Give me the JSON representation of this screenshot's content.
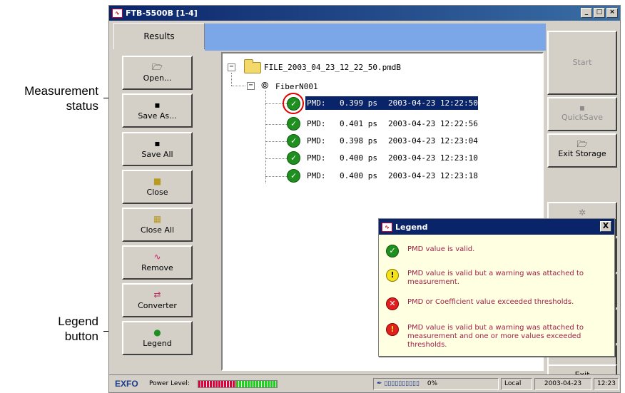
{
  "callouts": {
    "measurement_status_line1": "Measurement",
    "measurement_status_line2": "status",
    "legend_button_line1": "Legend",
    "legend_button_line2": "button"
  },
  "window": {
    "title": "FTB-5500B [1-4]",
    "minimize": "_",
    "maximize": "□",
    "close": "×"
  },
  "tabs": {
    "results": "Results"
  },
  "left_buttons": [
    {
      "label": "Open...",
      "icon": "open-folder-icon"
    },
    {
      "label": "Save As...",
      "icon": "floppy-icon"
    },
    {
      "label": "Save All",
      "icon": "floppy-icon"
    },
    {
      "label": "Close",
      "icon": "folder-icon"
    },
    {
      "label": "Close All",
      "icon": "folders-icon"
    },
    {
      "label": "Remove",
      "icon": "remove-icon"
    },
    {
      "label": "Converter",
      "icon": "converter-icon"
    },
    {
      "label": "Legend",
      "icon": "legend-icon"
    }
  ],
  "tree": {
    "file_name": "FILE_2003_04_23_12_22_50.pmdB",
    "fiber_name": "FiberN001",
    "measurements": [
      {
        "label": "PMD:",
        "value": "0.399 ps",
        "timestamp": "2003-04-23 12:22:50",
        "status": "valid",
        "selected": true
      },
      {
        "label": "PMD:",
        "value": "0.401 ps",
        "timestamp": "2003-04-23 12:22:56",
        "status": "valid",
        "selected": false
      },
      {
        "label": "PMD:",
        "value": "0.398 ps",
        "timestamp": "2003-04-23 12:23:04",
        "status": "valid",
        "selected": false
      },
      {
        "label": "PMD:",
        "value": "0.400 ps",
        "timestamp": "2003-04-23 12:23:10",
        "status": "valid",
        "selected": false
      },
      {
        "label": "PMD:",
        "value": "0.400 ps",
        "timestamp": "2003-04-23 12:23:18",
        "status": "valid",
        "selected": false
      }
    ]
  },
  "right_buttons": {
    "start": "Start",
    "quicksave": "QuickSave",
    "exit_storage": "Exit Storage",
    "exit": "Exit"
  },
  "legend": {
    "title": "Legend",
    "close": "X",
    "items": [
      {
        "status": "valid",
        "text": "PMD value is valid."
      },
      {
        "status": "warning",
        "text": "PMD value is valid but a warning was attached to measurement."
      },
      {
        "status": "exceeded",
        "text": "PMD or Coefficient value exceeded thresholds."
      },
      {
        "status": "warning-exceeded",
        "text": "PMD value is valid but a warning was attached to measurement and one or more values exceeded thresholds."
      }
    ]
  },
  "status_bar": {
    "brand": "EXFO",
    "power_label": "Power Level:",
    "power_level_fraction": 0.48,
    "battery_percent": "0%",
    "mode": "Local",
    "date": "2003-04-23",
    "time": "12:23"
  },
  "colors": {
    "title_bar": "#0a246a",
    "header_blue": "#7ba7e8",
    "selection": "#0a246a",
    "legend_text": "#a0214a",
    "valid_green": "#1f8f1f",
    "highlight_ring": "#e00000"
  }
}
